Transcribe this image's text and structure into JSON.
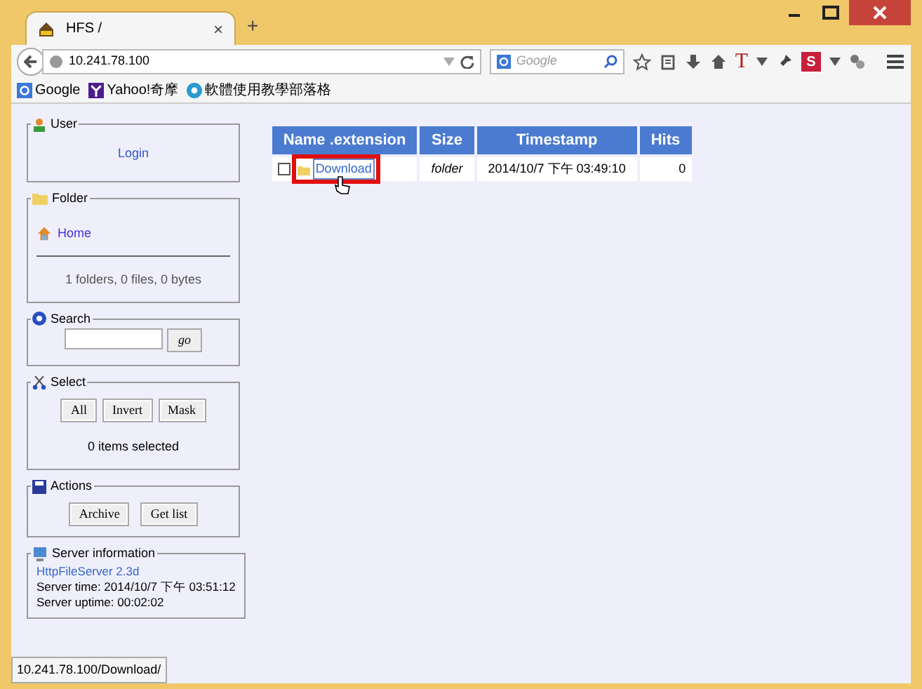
{
  "window": {
    "tab_title": "HFS /",
    "tab_close": "×",
    "new_tab": "+"
  },
  "toolbar": {
    "url": "10.241.78.100",
    "search_placeholder": "Google",
    "text_button": "T",
    "s_button": "S"
  },
  "bookmarks": [
    "Google",
    "Yahoo!奇摩",
    "軟體使用教學部落格"
  ],
  "sidebar": {
    "user": {
      "legend": "User",
      "login": "Login"
    },
    "folder": {
      "legend": "Folder",
      "home": "Home",
      "summary": "1 folders, 0 files, 0 bytes"
    },
    "search": {
      "legend": "Search",
      "button": "go"
    },
    "select": {
      "legend": "Select",
      "buttons": [
        "All",
        "Invert",
        "Mask"
      ],
      "status": "0 items selected"
    },
    "actions": {
      "legend": "Actions",
      "buttons": [
        "Archive",
        "Get list"
      ]
    },
    "server": {
      "legend": "Server information",
      "link": "HttpFileServer 2.3d",
      "lines": [
        "Server time: 2014/10/7 下午 03:51:12",
        "Server uptime: 00:02:02"
      ]
    }
  },
  "table": {
    "columns": [
      "Name .extension",
      "Size",
      "Timestamp",
      "Hits"
    ],
    "rows": [
      {
        "name": "Download",
        "checked": false,
        "highlighted": true,
        "size": "folder",
        "timestamp": "2014/10/7 下午 03:49:10",
        "hits": "0"
      }
    ]
  },
  "status_bar": "10.241.78.100/Download/"
}
